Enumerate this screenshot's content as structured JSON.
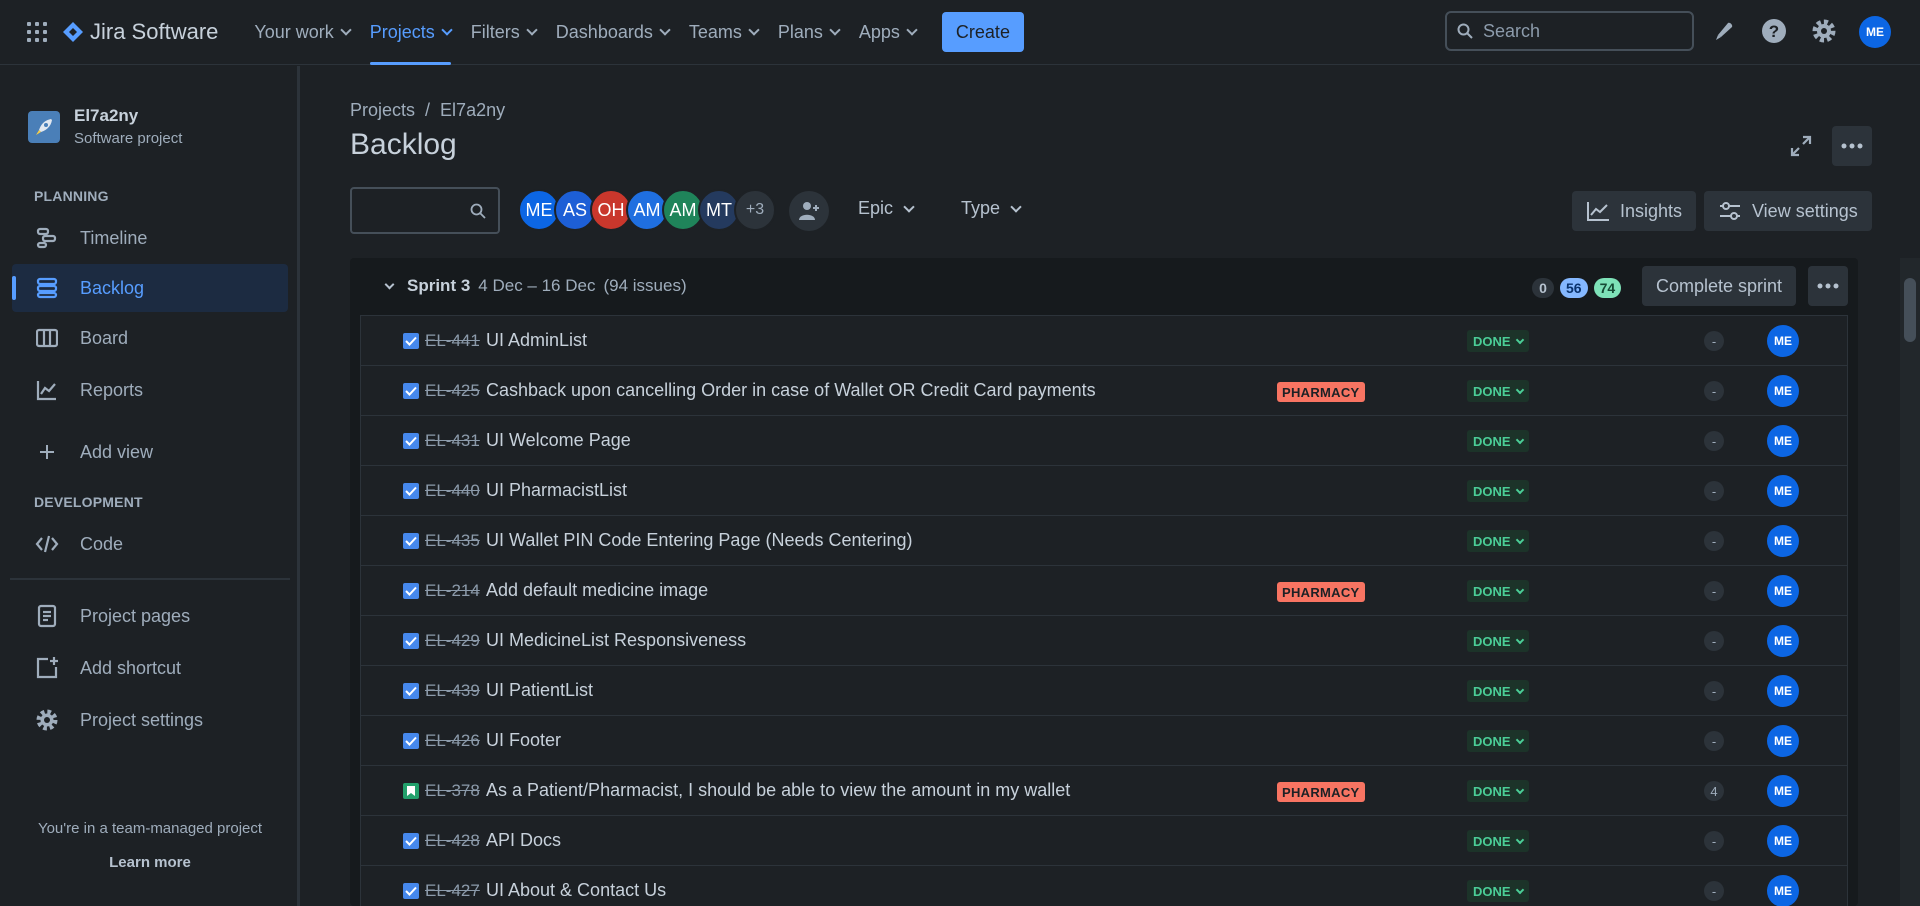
{
  "app": {
    "name": "Jira Software"
  },
  "nav": {
    "items": [
      {
        "label": "Your work",
        "active": false
      },
      {
        "label": "Projects",
        "active": true
      },
      {
        "label": "Filters",
        "active": false
      },
      {
        "label": "Dashboards",
        "active": false
      },
      {
        "label": "Teams",
        "active": false
      },
      {
        "label": "Plans",
        "active": false
      },
      {
        "label": "Apps",
        "active": false
      }
    ],
    "create_label": "Create",
    "search_placeholder": "Search",
    "user_initials": "ME"
  },
  "sidebar": {
    "project_name": "El7a2ny",
    "project_type": "Software project",
    "planning_heading": "PLANNING",
    "planning_items": [
      "Timeline",
      "Backlog",
      "Board",
      "Reports"
    ],
    "add_view_label": "Add view",
    "development_heading": "DEVELOPMENT",
    "code_label": "Code",
    "project_pages_label": "Project pages",
    "add_shortcut_label": "Add shortcut",
    "project_settings_label": "Project settings",
    "team_note": "You're in a team-managed project",
    "learn_more": "Learn more"
  },
  "header": {
    "breadcrumb_root": "Projects",
    "breadcrumb_sep": "/",
    "breadcrumb_project": "El7a2ny",
    "title": "Backlog"
  },
  "filters": {
    "avatars": [
      "ME",
      "AS",
      "OH",
      "AM",
      "AM",
      "MT"
    ],
    "avatar_colors": [
      "#0c66e4",
      "#1d5fd6",
      "#c9372c",
      "#1f6fe0",
      "#1f845a",
      "#243a5e"
    ],
    "more_avatars": "+3",
    "epic_label": "Epic",
    "type_label": "Type",
    "insights_label": "Insights",
    "view_settings_label": "View settings"
  },
  "sprint": {
    "name": "Sprint 3",
    "dates": "4 Dec – 16 Dec",
    "issue_count": "(94 issues)",
    "counts": {
      "todo": "0",
      "in_progress": "56",
      "done": "74"
    },
    "complete_label": "Complete sprint"
  },
  "issues": [
    {
      "type": "task",
      "key": "EL-441",
      "summary": "UI AdminList",
      "epic": "",
      "status": "DONE",
      "estimate": "-",
      "assignee": "ME"
    },
    {
      "type": "task",
      "key": "EL-425",
      "summary": "Cashback upon cancelling Order in case of Wallet OR Credit Card payments",
      "epic": "PHARMACY",
      "status": "DONE",
      "estimate": "-",
      "assignee": "ME"
    },
    {
      "type": "task",
      "key": "EL-431",
      "summary": "UI Welcome Page",
      "epic": "",
      "status": "DONE",
      "estimate": "-",
      "assignee": "ME"
    },
    {
      "type": "task",
      "key": "EL-440",
      "summary": "UI PharmacistList",
      "epic": "",
      "status": "DONE",
      "estimate": "-",
      "assignee": "ME"
    },
    {
      "type": "task",
      "key": "EL-435",
      "summary": "UI Wallet PIN Code Entering Page (Needs Centering)",
      "epic": "",
      "status": "DONE",
      "estimate": "-",
      "assignee": "ME"
    },
    {
      "type": "task",
      "key": "EL-214",
      "summary": "Add default medicine image",
      "epic": "PHARMACY",
      "status": "DONE",
      "estimate": "-",
      "assignee": "ME"
    },
    {
      "type": "task",
      "key": "EL-429",
      "summary": "UI MedicineList Responsiveness",
      "epic": "",
      "status": "DONE",
      "estimate": "-",
      "assignee": "ME"
    },
    {
      "type": "task",
      "key": "EL-439",
      "summary": "UI PatientList",
      "epic": "",
      "status": "DONE",
      "estimate": "-",
      "assignee": "ME"
    },
    {
      "type": "task",
      "key": "EL-426",
      "summary": "UI Footer",
      "epic": "",
      "status": "DONE",
      "estimate": "-",
      "assignee": "ME"
    },
    {
      "type": "story",
      "key": "EL-378",
      "summary": "As a Patient/Pharmacist, I should be able to view the amount in my wallet",
      "epic": "PHARMACY",
      "status": "DONE",
      "estimate": "4",
      "assignee": "ME"
    },
    {
      "type": "task",
      "key": "EL-428",
      "summary": "API Docs",
      "epic": "",
      "status": "DONE",
      "estimate": "-",
      "assignee": "ME"
    },
    {
      "type": "task",
      "key": "EL-427",
      "summary": "UI About & Contact Us",
      "epic": "",
      "status": "DONE",
      "estimate": "-",
      "assignee": "ME"
    }
  ],
  "colors": {
    "accent": "#579dff",
    "done_text": "#4bce97",
    "epic_bg": "#f87462",
    "story": "#22a06b",
    "task": "#4688ec"
  }
}
